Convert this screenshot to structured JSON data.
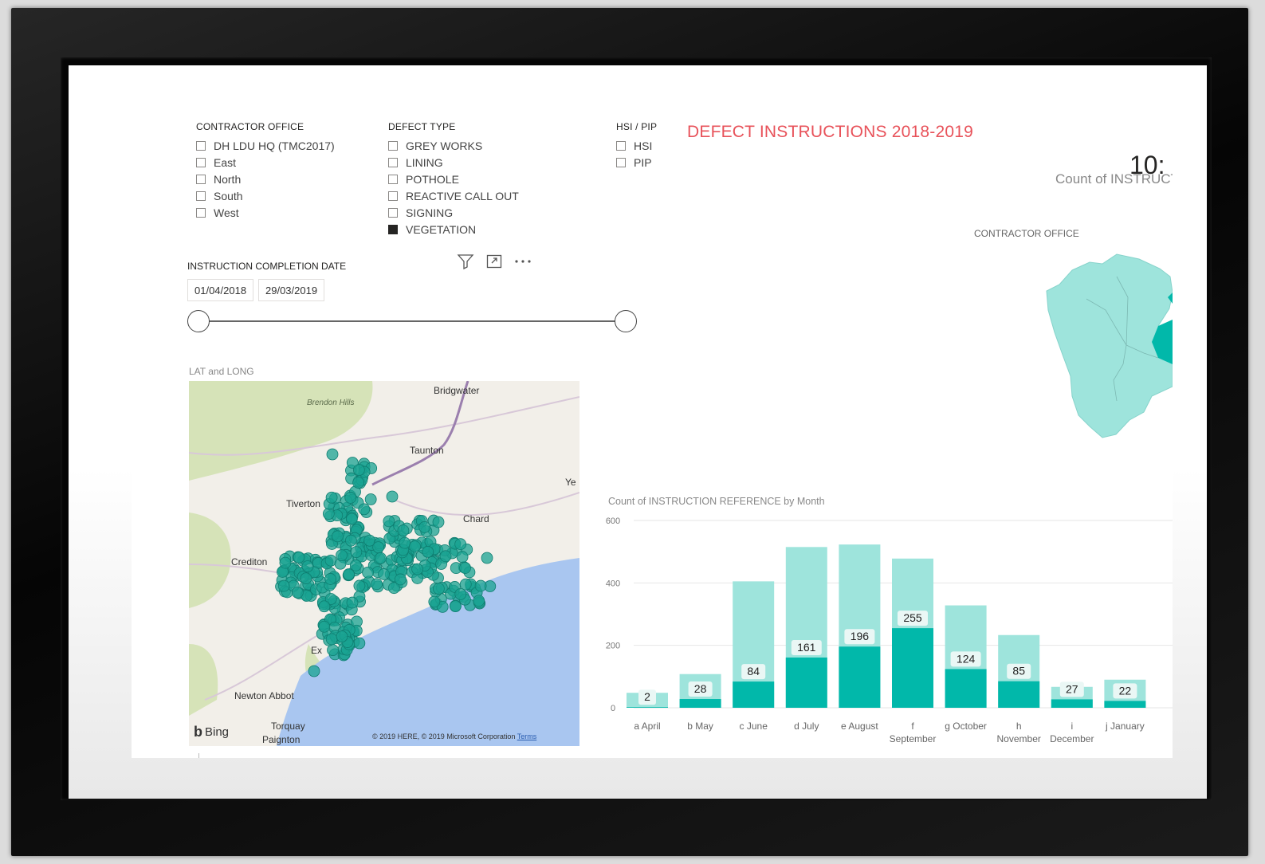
{
  "report": {
    "title": "DEFECT INSTRUCTIONS 2018-2019",
    "card_value": "10:",
    "card_label": "Count of INSTRUCT",
    "filled_map_title": "CONTRACTOR OFFICE"
  },
  "contractor_office": {
    "title": "CONTRACTOR OFFICE",
    "items": [
      {
        "label": "DH LDU HQ (TMC2017)",
        "checked": false
      },
      {
        "label": "East",
        "checked": false
      },
      {
        "label": "North",
        "checked": false
      },
      {
        "label": "South",
        "checked": false
      },
      {
        "label": "West",
        "checked": false
      }
    ]
  },
  "defect_type": {
    "title": "DEFECT TYPE",
    "items": [
      {
        "label": "GREY WORKS",
        "checked": false
      },
      {
        "label": "LINING",
        "checked": false
      },
      {
        "label": "POTHOLE",
        "checked": false
      },
      {
        "label": "REACTIVE CALL OUT",
        "checked": false
      },
      {
        "label": "SIGNING",
        "checked": false
      },
      {
        "label": "VEGETATION",
        "checked": true
      }
    ]
  },
  "hsi_pip": {
    "title": "HSI / PIP",
    "items": [
      {
        "label": "HSI",
        "checked": false
      },
      {
        "label": "PIP",
        "checked": false
      }
    ]
  },
  "visual_header_icons": [
    "filter-icon",
    "focus-mode-icon",
    "more-options-icon"
  ],
  "date_slicer": {
    "title": "INSTRUCTION COMPLETION DATE",
    "start": "01/04/2018",
    "end": "29/03/2019"
  },
  "lat_long_map": {
    "title": "LAT and LONG",
    "places": [
      "Bridgwater",
      "Brendon Hills",
      "Taunton",
      "Ye",
      "Tiverton",
      "Chard",
      "Crediton",
      "Ex",
      "Newton Abbot",
      "Torquay",
      "Paignton"
    ],
    "bing_label": "Bing",
    "copyright": "© 2019 HERE, © 2019 Microsoft Corporation",
    "terms_link": "Terms",
    "point_color": "#1aa391"
  },
  "colors": {
    "accent": "#01b8aa",
    "accent_light": "#9ee4dc",
    "title_red": "#e8525a"
  },
  "chart_data": {
    "type": "bar",
    "title": "Count of INSTRUCTION REFERENCE by Month",
    "categories": [
      [
        "a April"
      ],
      [
        "b May"
      ],
      [
        "c June"
      ],
      [
        "d July"
      ],
      [
        "e August"
      ],
      [
        "f",
        "September"
      ],
      [
        "g October"
      ],
      [
        "h",
        "November"
      ],
      [
        "i",
        "December"
      ],
      [
        "j January"
      ]
    ],
    "series": [
      {
        "values": [
          48,
          108,
          405,
          515,
          523,
          478,
          328,
          233,
          67,
          90
        ]
      },
      {
        "values": [
          2,
          28,
          84,
          161,
          196,
          255,
          124,
          85,
          27,
          22
        ]
      }
    ],
    "yticks": [
      0,
      200,
      400,
      600
    ],
    "ylim": [
      0,
      600
    ],
    "grid": true
  }
}
